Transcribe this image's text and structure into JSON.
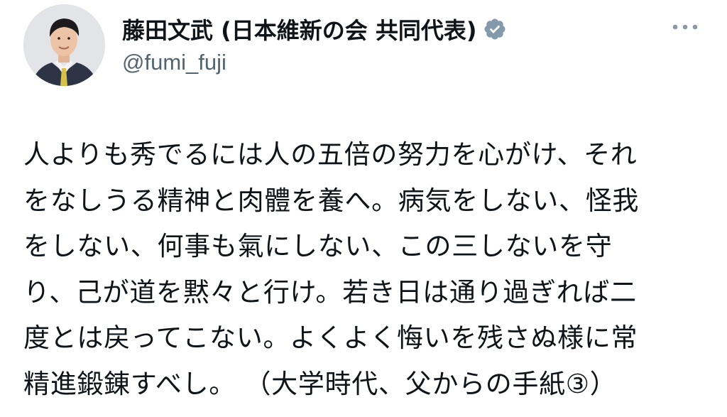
{
  "author": {
    "display_name": "藤田文武 (日本維新の会 共同代表)",
    "handle": "@fumi_fuji",
    "verified": true,
    "badge_color": "#829aab"
  },
  "icons": {
    "avatar": "profile-photo",
    "badge": "verified-badge-icon",
    "more": "more-horizontal-icon"
  },
  "tweet": {
    "lines": [
      "人よりも秀でるには人の五倍の努力を心がけ、それ",
      "をなしうる精神と肉體を養へ。病気をしない、怪我",
      "をしない、何事も氣にしない、この三しないを守",
      "り、己が道を黙々と行け。若き日は通り過ぎれば二",
      "度とは戻ってこない。よくよく悔いを残さぬ様に常",
      "精進鍛錬すべし。 （大学時代、父からの手紙③）"
    ]
  }
}
